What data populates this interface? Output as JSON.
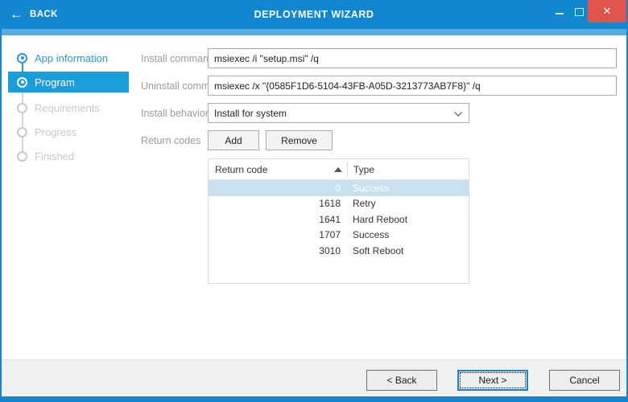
{
  "window": {
    "back_label": "BACK",
    "title": "DEPLOYMENT WIZARD",
    "icons": {
      "back_arrow": "←",
      "close": "✕"
    },
    "colors": {
      "titlebar": "#1287D0",
      "substrip": "#55AEE1",
      "close_button": "#E1544B",
      "active_step": "#1B9DDB",
      "accent_blue": "#2E96D8",
      "selected_row": "#C9E0EF"
    }
  },
  "stepper": {
    "items": [
      {
        "label": "App information",
        "state": "completed"
      },
      {
        "label": "Program",
        "state": "active"
      },
      {
        "label": "Requirements",
        "state": "pending"
      },
      {
        "label": "Progress",
        "state": "pending"
      },
      {
        "label": "Finished",
        "state": "pending"
      }
    ]
  },
  "form": {
    "install_command": {
      "label": "Install command",
      "value": "msiexec /i \"setup.msi\" /q"
    },
    "uninstall_command": {
      "label": "Uninstall command",
      "value": "msiexec /x \"{0585F1D6-5104-43FB-A05D-3213773AB7F8}\" /q"
    },
    "install_behavior": {
      "label": "Install behavior",
      "value": "Install for system"
    },
    "return_codes": {
      "label": "Return codes",
      "add_label": "Add",
      "remove_label": "Remove"
    }
  },
  "table": {
    "columns": [
      "Return code",
      "Type"
    ],
    "sort": {
      "column": "Return code",
      "direction": "ascending"
    },
    "rows": [
      {
        "code": "0",
        "type": "Success",
        "selected": true
      },
      {
        "code": "1618",
        "type": "Retry",
        "selected": false
      },
      {
        "code": "1641",
        "type": "Hard Reboot",
        "selected": false
      },
      {
        "code": "1707",
        "type": "Success",
        "selected": false
      },
      {
        "code": "3010",
        "type": "Soft Reboot",
        "selected": false
      }
    ]
  },
  "footer": {
    "back_label": "< Back",
    "next_label": "Next >",
    "cancel_label": "Cancel"
  }
}
